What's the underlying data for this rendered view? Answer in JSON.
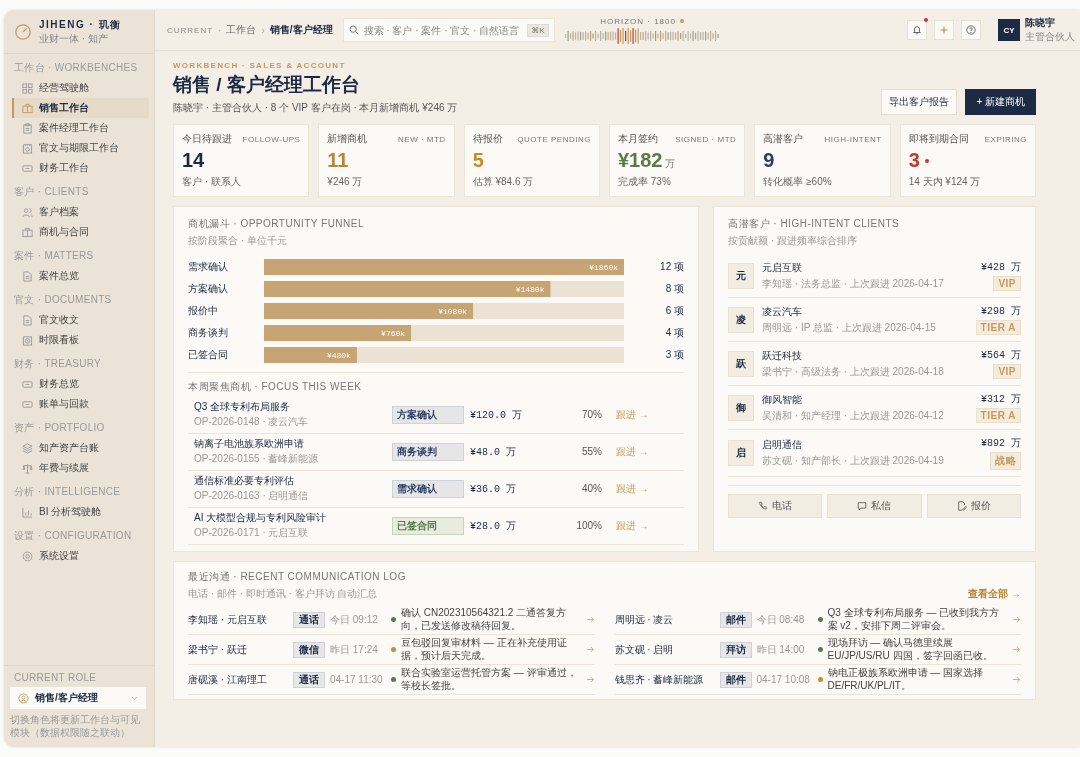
{
  "brand": {
    "name": "JIHENG · 玑衡",
    "tagline": "业财一体 · 知产"
  },
  "sidebar": {
    "sections": [
      {
        "title": "工作台 · WORKBENCHES",
        "items": [
          {
            "label": "经营驾驶舱",
            "selected": false
          },
          {
            "label": "销售工作台",
            "selected": true
          },
          {
            "label": "案件经理工作台",
            "selected": false
          },
          {
            "label": "官文与期限工作台",
            "selected": false
          },
          {
            "label": "财务工作台",
            "selected": false
          }
        ]
      },
      {
        "title": "客户 · CLIENTS",
        "items": [
          {
            "label": "客户档案",
            "selected": false
          },
          {
            "label": "商机与合同",
            "selected": false
          }
        ]
      },
      {
        "title": "案件 · MATTERS",
        "items": [
          {
            "label": "案件总览",
            "selected": false
          }
        ]
      },
      {
        "title": "官文 · DOCUMENTS",
        "items": [
          {
            "label": "官文收文",
            "selected": false
          },
          {
            "label": "时限看板",
            "selected": false
          }
        ]
      },
      {
        "title": "财务 · TREASURY",
        "items": [
          {
            "label": "财务总览",
            "selected": false
          },
          {
            "label": "账单与回款",
            "selected": false
          }
        ]
      },
      {
        "title": "资产 · PORTFOLIO",
        "items": [
          {
            "label": "知产资产台账",
            "selected": false
          },
          {
            "label": "年费与续展",
            "selected": false
          }
        ]
      },
      {
        "title": "分析 · INTELLIGENCE",
        "items": [
          {
            "label": "BI 分析驾驶舱",
            "selected": false
          }
        ]
      },
      {
        "title": "设置 · CONFIGURATION",
        "items": [
          {
            "label": "系统设置",
            "selected": false
          }
        ]
      }
    ],
    "role": {
      "title": "CURRENT ROLE",
      "value": "销售/客户经理",
      "note": "切换角色将更新工作台与可见模块（数据权限随之联动）"
    }
  },
  "topbar": {
    "breadcrumb": [
      "CURRENT",
      "工作台",
      "销售/客户经理"
    ],
    "separators": [
      "·",
      "›"
    ],
    "search": {
      "placeholder": "搜索 · 客户 · 案件 · 官文 · 自然语言",
      "shortcut": "⌘K"
    },
    "horizon": "HORIZON · 1800",
    "notifications_unread": true,
    "user": {
      "initials": "CY",
      "name": "陈晓宇",
      "role": "主管合伙人"
    }
  },
  "header": {
    "eyebrow": "WORKBENCH · SALES & ACCOUNT",
    "title": "销售 / 客户经理工作台",
    "subtitle": "陈晓宇 · 主管合伙人 · 8 个 VIP 客户在岗 · 本月新增商机 ¥246 万",
    "buttons": [
      "导出客户报告",
      "+ 新建商机"
    ]
  },
  "kpis": [
    {
      "label": "今日待跟进",
      "label_en": "FOLLOW-UPS",
      "value": "14",
      "sub": "客户 · 联系人",
      "color": "#1d2a44",
      "alert": false
    },
    {
      "label": "新增商机",
      "label_en": "NEW · MTD",
      "value": "11",
      "sub": "¥246 万",
      "color": "#b8843a",
      "alert": false
    },
    {
      "label": "待报价",
      "label_en": "QUOTE PENDING",
      "value": "5",
      "sub": "估算 ¥84.6 万",
      "color": "#c8872a",
      "alert": false
    },
    {
      "label": "本月签约",
      "label_en": "SIGNED · MTD",
      "value": "¥182",
      "unit": "万",
      "sub": "完成率 73%",
      "color": "#5a7a4a",
      "alert": false
    },
    {
      "label": "高潜客户",
      "label_en": "HIGH-INTENT",
      "value": "9",
      "sub": "转化概率 ≥60%",
      "color": "#2c3e66",
      "alert": false
    },
    {
      "label": "即将到期合同",
      "label_en": "EXPIRING",
      "value": "3",
      "sub": "14 天内 ¥124 万",
      "color": "#c0392b",
      "alert": true
    }
  ],
  "funnel": {
    "title": "商机漏斗 · OPPORTUNITY FUNNEL",
    "subtitle": "按阶段聚合 · 单位千元",
    "chart_data": {
      "type": "bar",
      "orientation": "horizontal",
      "categories": [
        "需求确认",
        "方案确认",
        "报价中",
        "商务谈判",
        "已签合同"
      ],
      "values": [
        1860,
        1480,
        1080,
        760,
        480
      ],
      "xlim": [
        0,
        1860
      ],
      "value_labels": [
        "¥1860k",
        "¥1480k",
        "¥1080k",
        "¥760k",
        "¥480k"
      ]
    },
    "counts": [
      "12 项",
      "8 项",
      "6 项",
      "4 项",
      "3 项"
    ]
  },
  "focus": {
    "title": "本周聚焦商机 · FOCUS THIS WEEK",
    "rows": [
      {
        "title": "Q3 全球专利布局服务",
        "code": "OP-2026-0148 · 凌云汽车",
        "stage": "方案确认",
        "kind": "open",
        "amount": "¥120.0 万",
        "pct": "70%",
        "action": "跟进 →"
      },
      {
        "title": "钠离子电池族系欧洲申请",
        "code": "OP-2026-0155 · 蓄峰新能源",
        "stage": "商务谈判",
        "kind": "open",
        "amount": "¥48.0 万",
        "pct": "55%",
        "action": "跟进 →"
      },
      {
        "title": "通信标准必要专利评估",
        "code": "OP-2026-0163 · 启明通信",
        "stage": "需求确认",
        "kind": "open",
        "amount": "¥36.0 万",
        "pct": "40%",
        "action": "跟进 →"
      },
      {
        "title": "AI 大模型合规与专利风险审计",
        "code": "OP-2026-0171 · 元启互联",
        "stage": "已签合同",
        "kind": "signed",
        "amount": "¥28.0 万",
        "pct": "100%",
        "action": "跟进 →"
      }
    ]
  },
  "clients": {
    "title": "高潜客户 · HIGH-INTENT CLIENTS",
    "subtitle": "按贡献额 · 跟进频率综合排序",
    "rows": [
      {
        "avatar": "元",
        "name": "元启互联",
        "meta": "李知瑶 · 法务总监 · 上次跟进 2026-04-17",
        "amount": "¥428 万",
        "tier": "VIP"
      },
      {
        "avatar": "凌",
        "name": "凌云汽车",
        "meta": "周明远 · IP 总监 · 上次跟进 2026-04-15",
        "amount": "¥298 万",
        "tier": "TIER A"
      },
      {
        "avatar": "跃",
        "name": "跃迁科技",
        "meta": "梁书宁 · 高级法务 · 上次跟进 2026-04-18",
        "amount": "¥564 万",
        "tier": "VIP"
      },
      {
        "avatar": "御",
        "name": "御风智能",
        "meta": "吴清和 · 知产经理 · 上次跟进 2026-04-12",
        "amount": "¥312 万",
        "tier": "TIER A"
      },
      {
        "avatar": "启",
        "name": "启明通信",
        "meta": "苏文砚 · 知产部长 · 上次跟进 2026-04-19",
        "amount": "¥892 万",
        "tier": "战略"
      }
    ],
    "actions": [
      {
        "label": "电话",
        "kind": "phone"
      },
      {
        "label": "私信",
        "kind": "message"
      },
      {
        "label": "报价",
        "kind": "quote"
      }
    ]
  },
  "log": {
    "title": "最近沟通 · RECENT COMMUNICATION LOG",
    "subtitle": "电话 · 邮件 · 即时通讯 · 客户拜访 自动汇总",
    "view_all": "查看全部 →",
    "entries": [
      {
        "who": "李知瑶 · 元启互联",
        "channel": "通话",
        "time": "今日 09:12",
        "color": "#5a7a4a",
        "text": "确认 CN202310564321.2 二通答复方向，已发送修改稿待回复。"
      },
      {
        "who": "周明远 · 凌云",
        "channel": "邮件",
        "time": "今日 08:48",
        "color": "#5a7a4a",
        "text": "Q3 全球专利布局服务 — 已收到我方方案 v2，安排下周二评审会。"
      },
      {
        "who": "梁书宁 · 跃迁",
        "channel": "微信",
        "time": "昨日 17:24",
        "color": "#d08a2a",
        "text": "豆包驳回复审材料 — 正在补充使用证据，预计后天完成。"
      },
      {
        "who": "苏文砚 · 启明",
        "channel": "拜访",
        "time": "昨日 14:00",
        "color": "#5a7a4a",
        "text": "现场拜访 — 确认马德里续展 EU/JP/US/RU 四国，签字回函已收。"
      },
      {
        "who": "唐砚溪 · 江南理工",
        "channel": "通话",
        "time": "04-17 11:30",
        "color": "#5a7a4a",
        "text": "联合实验室运营托管方案 — 评审通过，等校长签批。"
      },
      {
        "who": "钱思齐 · 蓄峰新能源",
        "channel": "邮件",
        "time": "04-17 10:08",
        "color": "#d08a2a",
        "text": "钠电正极族系欧洲申请 — 国家选择 DE/FR/UK/PL/IT。"
      }
    ]
  }
}
